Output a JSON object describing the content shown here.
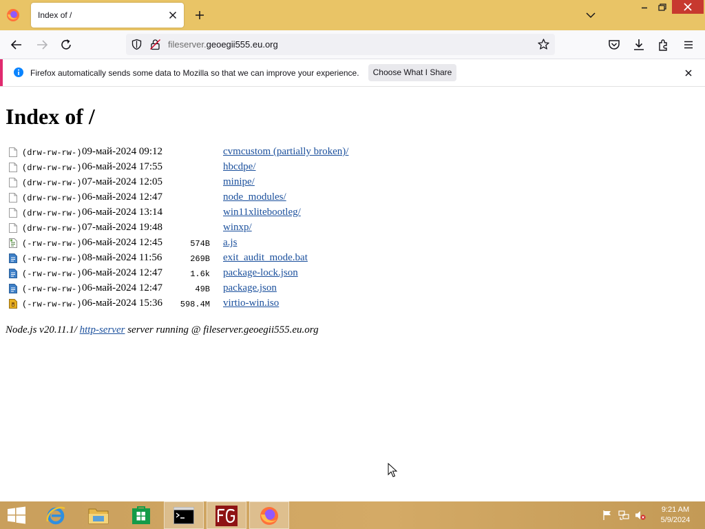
{
  "browser": {
    "tab_title": "Index of /",
    "url_host_prefix": "fileserver.",
    "url_host_domain": "geoegii555.eu.org"
  },
  "notification": {
    "text": "Firefox automatically sends some data to Mozilla so that we can improve your experience.",
    "button_label": "Choose What I Share"
  },
  "page": {
    "title": "Index of /",
    "files": [
      {
        "perm": "(drw-rw-rw-)",
        "date": "09-май-2024 09:12",
        "size": "",
        "name": "cvmcustom (partially broken)/",
        "icon": "folder-file-icon"
      },
      {
        "perm": "(drw-rw-rw-)",
        "date": "06-май-2024 17:55",
        "size": "",
        "name": "hbcdpe/",
        "icon": "folder-file-icon"
      },
      {
        "perm": "(drw-rw-rw-)",
        "date": "07-май-2024 12:05",
        "size": "",
        "name": "minipe/",
        "icon": "folder-file-icon"
      },
      {
        "perm": "(drw-rw-rw-)",
        "date": "06-май-2024 12:47",
        "size": "",
        "name": "node_modules/",
        "icon": "folder-file-icon"
      },
      {
        "perm": "(drw-rw-rw-)",
        "date": "06-май-2024 13:14",
        "size": "",
        "name": "win11xlitebootleg/",
        "icon": "folder-file-icon"
      },
      {
        "perm": "(drw-rw-rw-)",
        "date": "07-май-2024 19:48",
        "size": "",
        "name": "winxp/",
        "icon": "folder-file-icon"
      },
      {
        "perm": "(-rw-rw-rw-)",
        "date": "06-май-2024 12:45",
        "size": "574B",
        "name": "a.js",
        "icon": "script-file-icon"
      },
      {
        "perm": "(-rw-rw-rw-)",
        "date": "08-май-2024 11:56",
        "size": "269B",
        "name": "exit_audit_mode.bat",
        "icon": "text-file-icon"
      },
      {
        "perm": "(-rw-rw-rw-)",
        "date": "06-май-2024 12:47",
        "size": "1.6k",
        "name": "package-lock.json",
        "icon": "text-file-icon"
      },
      {
        "perm": "(-rw-rw-rw-)",
        "date": "06-май-2024 12:47",
        "size": "49B",
        "name": "package.json",
        "icon": "text-file-icon"
      },
      {
        "perm": "(-rw-rw-rw-)",
        "date": "06-май-2024 15:36",
        "size": "598.4M",
        "name": "virtio-win.iso",
        "icon": "archive-file-icon"
      }
    ],
    "footer": {
      "prefix": "Node.js v20.11.1/ ",
      "link": "http-server",
      "suffix": " server running @ fileserver.geoegii555.eu.org"
    }
  },
  "taskbar": {
    "clock_time": "9:21 AM",
    "clock_date": "5/9/2024"
  },
  "colors": {
    "tab_bar": "#e9c466",
    "link": "#1a4f9c",
    "notification_stripe": "#e02b6f",
    "close_button": "#c7392f"
  }
}
